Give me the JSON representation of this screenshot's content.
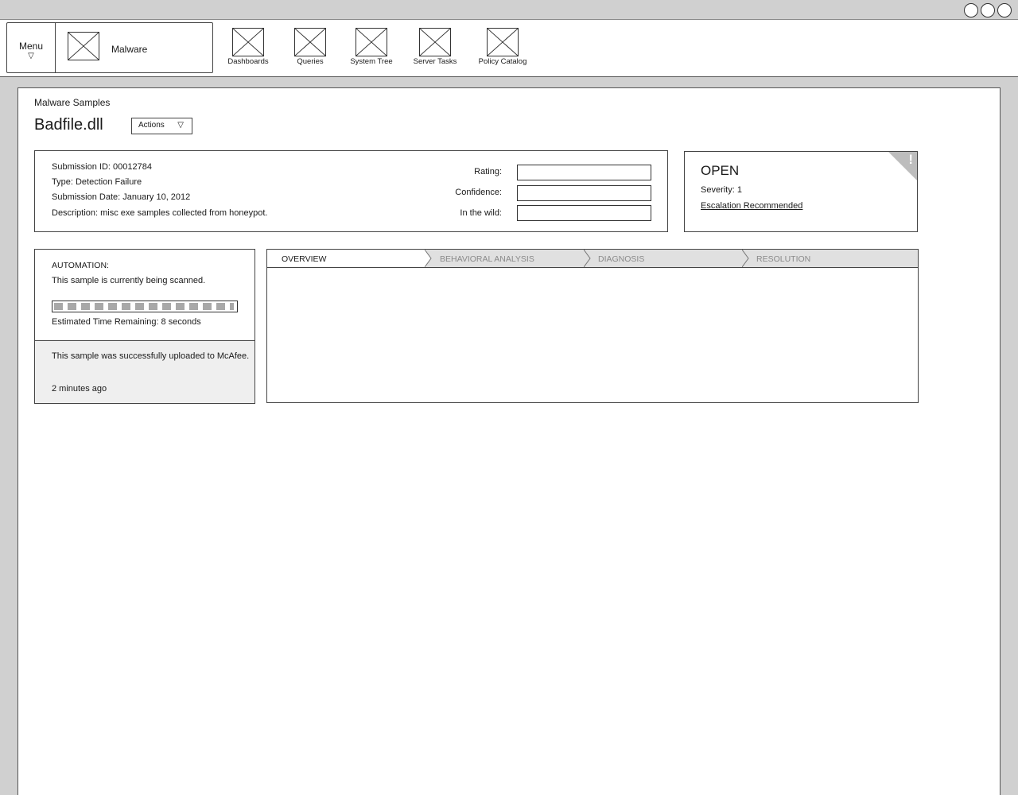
{
  "app": {
    "menu_label": "Menu",
    "brand_title": "Malware"
  },
  "nav": {
    "items": [
      {
        "label": "Dashboards"
      },
      {
        "label": "Queries"
      },
      {
        "label": "System Tree"
      },
      {
        "label": "Server Tasks"
      },
      {
        "label": "Policy Catalog"
      }
    ]
  },
  "page": {
    "breadcrumb": "Malware Samples",
    "title": "Badfile.dll",
    "actions_label": "Actions"
  },
  "details": {
    "submission_id": "Submission ID: 00012784",
    "type": "Type: Detection Failure",
    "submission_date": "Submission Date: January 10, 2012",
    "description": "Description: misc exe samples collected from honeypot.",
    "rating_label": "Rating:",
    "rating_value": "",
    "confidence_label": "Confidence:",
    "confidence_value": "",
    "in_the_wild_label": "In the wild:",
    "in_the_wild_value": ""
  },
  "status": {
    "state": "OPEN",
    "severity": "Severity: 1",
    "escalation": "Escalation Recommended",
    "flag_glyph": "!",
    "flag_color": "#bdbdbd"
  },
  "automation": {
    "heading": "AUTOMATION:",
    "message": "This sample is currently being scanned.",
    "progress_fraction": 0.99,
    "eta": "Estimated Time Remaining: 8 seconds",
    "notice": "This sample was successfully uploaded to McAfee.",
    "notice_time": "2 minutes ago"
  },
  "tabs": [
    {
      "label": "OVERVIEW",
      "active": true
    },
    {
      "label": "BEHAVIORAL ANALYSIS",
      "active": false
    },
    {
      "label": "DIAGNOSIS",
      "active": false
    },
    {
      "label": "RESOLUTION",
      "active": false
    }
  ],
  "icons": {
    "window_buttons": [
      "window-circle-icon",
      "window-circle-icon",
      "window-circle-icon"
    ],
    "placeholder": "image-placeholder-icon",
    "caret": "chevron-down-icon"
  }
}
